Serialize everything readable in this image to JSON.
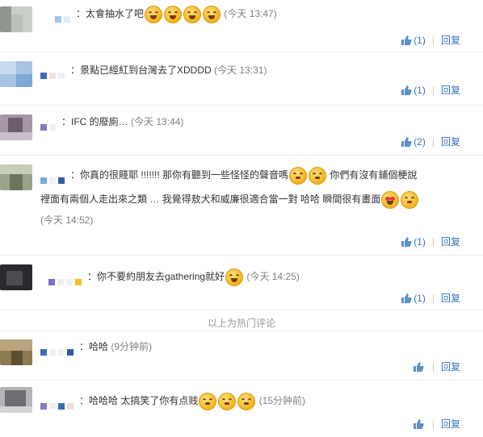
{
  "comments": [
    {
      "text": "：太會抽水了吧",
      "time": "(今天 13:47)",
      "likes": "(1)",
      "reply": "回复",
      "emojis": 4
    },
    {
      "text": "：景點已經紅到台灣去了XDDDD",
      "time": "(今天 13:31)",
      "likes": "(1)",
      "reply": "回复"
    },
    {
      "text": "：IFC 的廢廁…",
      "time": "(今天 13:44)",
      "likes": "(2)",
      "reply": "回复"
    },
    {
      "text_a": "：你真的很賤耶 !!!!!!! 那你有聽到一些怪怪的聲音嗎",
      "text_b": " 你們有沒有鋪個梗說",
      "text_c": "裡面有兩個人走出來之類 … 我覺得敖犬和威廉很適合當一對 哈哈 瞬間很有畫面",
      "time": "(今天 14:52)",
      "likes": "(1)",
      "reply": "回复"
    },
    {
      "text": "：你不要約朋友去gathering就好",
      "time": "(今天 14:25)",
      "likes": "(1)",
      "reply": "回复"
    },
    {
      "text": "：哈哈",
      "time": "(9分钟前)",
      "likes": "",
      "reply": "回复"
    },
    {
      "text": "：哈哈哈 太搞笑了你有点贱",
      "time": "(15分钟前)",
      "likes": "",
      "reply": "回复"
    }
  ],
  "divider": "以上为热门评论",
  "colors": {
    "link": "#3a72b8",
    "time": "#808080",
    "divider": "#999999"
  }
}
